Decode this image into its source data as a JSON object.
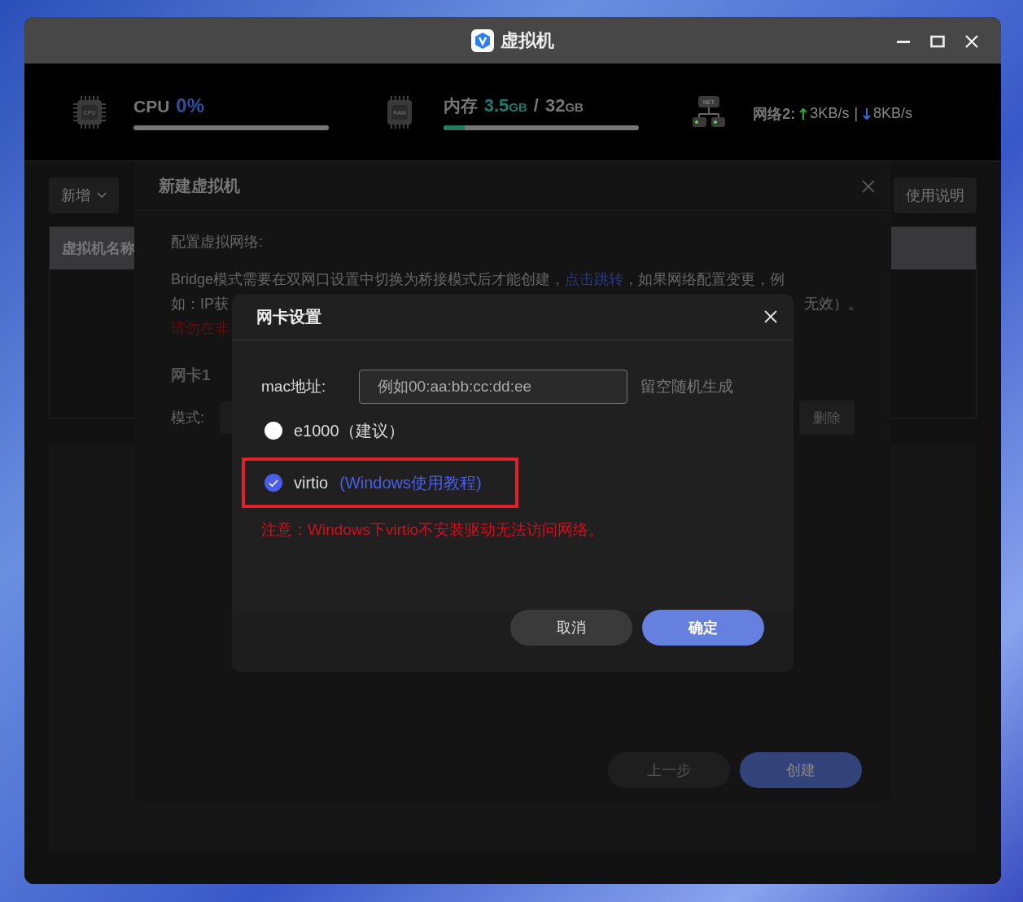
{
  "window": {
    "title": "虚拟机"
  },
  "stats": [
    {
      "kind": "cpu",
      "icon_label": "CPU",
      "label": "CPU",
      "value": "0%"
    },
    {
      "kind": "memory",
      "icon_label": "RAM",
      "label": "内存",
      "used": "3.5",
      "used_unit": "GB",
      "separator": "/",
      "total": "32",
      "total_unit": "GB",
      "level": 0.11
    },
    {
      "kind": "network",
      "icon_label": "NET",
      "label": "网络2:",
      "up": "3KB/s",
      "divider": "|",
      "down": "8KB/s"
    }
  ],
  "toolbar": {
    "add_button": "新增",
    "help_button": "使用说明"
  },
  "table": {
    "columns": [
      "虚拟机名称"
    ]
  },
  "create_dialog": {
    "title": "新建虚拟机",
    "section": "配置虚拟网络:",
    "line_1": {
      "before": "Bridge模式需要在双网口设置中切换为桥接模式后才能创建，",
      "link": "点击跳转",
      "after": "，如果网络配置变更，例"
    },
    "line_2": {
      "left": "如：IP获",
      "right": "无效）。"
    },
    "warning": "请勿在非",
    "nic_title": "网卡1",
    "mode_label": "模式:",
    "delete_button": "删除",
    "buttons": [
      {
        "label": "上一步",
        "kind": "secondary"
      },
      {
        "label": "创建",
        "kind": "primary"
      }
    ]
  },
  "nic_dialog": {
    "title": "网卡设置",
    "mac_label": "mac地址:",
    "mac_field": {
      "placeholder": "例如00:aa:bb:cc:dd:ee"
    },
    "mac_hint": "留空随机生成",
    "options": [
      {
        "label": "e1000（建议）",
        "selected": false,
        "highlighted": false
      },
      {
        "label": "virtio",
        "link": "(Windows使用教程)",
        "selected": true,
        "highlighted": true
      }
    ],
    "notice": "注意：Windows下virtio不安装驱动无法访问网络。",
    "buttons": [
      {
        "label": "取消",
        "kind": "secondary"
      },
      {
        "label": "确定",
        "kind": "primary"
      }
    ]
  }
}
